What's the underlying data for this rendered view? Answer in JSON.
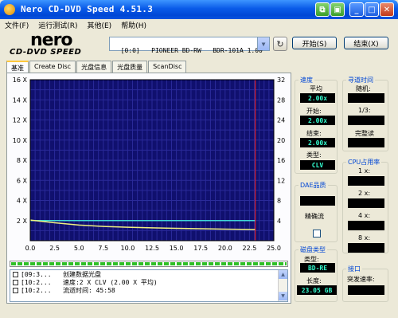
{
  "window": {
    "title": "Nero CD-DVD Speed 4.51.3"
  },
  "menu": [
    "文件(F)",
    "运行测试(R)",
    "其他(E)",
    "帮助(H)"
  ],
  "logo": {
    "line1": "nero",
    "line2": "CD-DVD SPEED"
  },
  "drive": {
    "selected": "[0:0]   PIONEER BD-RW   BDR-101A 1.00"
  },
  "buttons": {
    "start": "开始(S)",
    "exit": "结束(X)"
  },
  "tabs": [
    "基准",
    "Create Disc",
    "光盘信息",
    "光盘质量",
    "ScanDisc"
  ],
  "chart_data": {
    "type": "line",
    "x_ticks": [
      "0.0",
      "2.5",
      "5.0",
      "7.5",
      "10.0",
      "12.5",
      "15.0",
      "17.5",
      "20.0",
      "22.5",
      "25.0"
    ],
    "y_left_ticks": [
      "16 X",
      "14 X",
      "12 X",
      "10 X",
      "8 X",
      "6 X",
      "4 X",
      "2 X"
    ],
    "y_right_ticks": [
      "32",
      "28",
      "24",
      "20",
      "16",
      "12",
      "8",
      "4"
    ],
    "xlim": [
      0,
      25
    ],
    "ylim": [
      0,
      16
    ],
    "y2lim": [
      0,
      32
    ],
    "grid": true,
    "colors": {
      "background": "#10106e",
      "grid": "#2a2a9a",
      "speed": "#f0f080",
      "seek": "#40d8d8",
      "marker": "#ff2020"
    },
    "series": [
      {
        "x": [
          0,
          2.5,
          5,
          7.5,
          10,
          12.5,
          15,
          17.5,
          20,
          22.5,
          23.1
        ],
        "values": [
          2.05,
          1.78,
          1.55,
          1.42,
          1.34,
          1.28,
          1.23,
          1.19,
          1.15,
          1.12,
          1.11
        ]
      },
      {
        "x": [
          0,
          23.1
        ],
        "values": [
          2.0,
          2.0
        ]
      }
    ],
    "marker_x": 23.1
  },
  "progress": 1.0,
  "log": [
    {
      "time": "[09:3...",
      "text": "创建数据光盘"
    },
    {
      "time": "[10:2...",
      "text": "速度:2 X CLV (2.00 X 平均)"
    },
    {
      "time": "[10:2...",
      "text": "流逝时间: 45:58"
    }
  ],
  "speed": {
    "title": "速度",
    "avg_label": "平均",
    "avg": "2.00x",
    "start_label": "开始:",
    "start": "2.00x",
    "end_label": "结束:",
    "end": "2.00x",
    "type_label": "类型:",
    "type": "CLV"
  },
  "seek": {
    "title": "寻道时间",
    "random_label": "随机:",
    "third_label": "1/3:",
    "full_label": "完整读"
  },
  "dae": {
    "title": "DAE品质",
    "accurate_label": "精确流"
  },
  "cpu": {
    "title": "CPU占用率",
    "x1": "1 x:",
    "x2": "2 x:",
    "x4": "4 x:",
    "x8": "8 x:"
  },
  "disc": {
    "title": "磁盘类型",
    "type_label": "类型:",
    "type": "BD-RE",
    "length_label": "长度:",
    "length": "23.05 GB"
  },
  "interface": {
    "title": "接口",
    "burst_label": "突发速率:"
  }
}
